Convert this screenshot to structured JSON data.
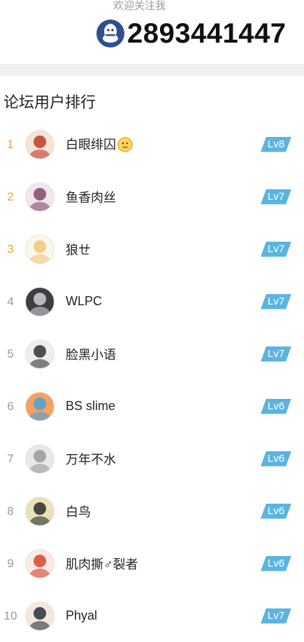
{
  "header": {
    "follow_caption": "欢迎关注我",
    "qq_number": "2893441447",
    "qq_icon": "qq-penguin-icon"
  },
  "section": {
    "title": "论坛用户排行"
  },
  "colors": {
    "top_rank": "#f3a333",
    "rank": "#9a9a9a",
    "badge": "#5bb4e0",
    "qq_icon_bg": "#2f4f8f"
  },
  "ranking": [
    {
      "rank": "1",
      "name": "白眼绯囚",
      "level": "Lv8",
      "avatar_bg": "#f5e3d3",
      "avatar_fg": "#c0392b",
      "emoji": true
    },
    {
      "rank": "2",
      "name": "鱼香肉丝",
      "level": "Lv7",
      "avatar_bg": "#f0e6ee",
      "avatar_fg": "#7d4a6b"
    },
    {
      "rank": "3",
      "name": "狼ㄝ",
      "level": "Lv7",
      "avatar_bg": "#fbf6ea",
      "avatar_fg": "#f0c777"
    },
    {
      "rank": "4",
      "name": "WLPC",
      "level": "Lv7",
      "avatar_bg": "#3d3d44",
      "avatar_fg": "#cfcfd6"
    },
    {
      "rank": "5",
      "name": "脸黑小语",
      "level": "Lv7",
      "avatar_bg": "#eeeeee",
      "avatar_fg": "#333333"
    },
    {
      "rank": "6",
      "name": "BS slime",
      "level": "Lv6",
      "avatar_bg": "#f3a264",
      "avatar_fg": "#4aa3d6"
    },
    {
      "rank": "7",
      "name": "万年不水",
      "level": "Lv6",
      "avatar_bg": "#e8e8e8",
      "avatar_fg": "#9a9a9a"
    },
    {
      "rank": "8",
      "name": "白鸟",
      "level": "Lv6",
      "avatar_bg": "#e9e2b8",
      "avatar_fg": "#2b2b2b"
    },
    {
      "rank": "9",
      "name": "肌肉撕♂裂者",
      "level": "Lv6",
      "avatar_bg": "#fbe9e3",
      "avatar_fg": "#d8442c"
    },
    {
      "rank": "10",
      "name": "Phyal",
      "level": "Lv7",
      "avatar_bg": "#f2e8e0",
      "avatar_fg": "#2a2e3d"
    }
  ]
}
